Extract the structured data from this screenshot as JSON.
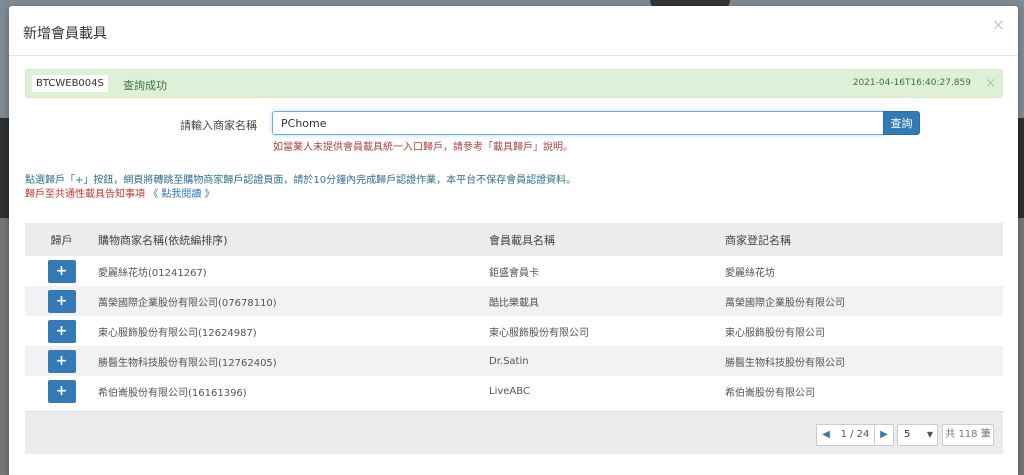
{
  "modal": {
    "title": "新增會員載具",
    "close_glyph": "×"
  },
  "alert": {
    "code": "BTCWEB004S",
    "message": "查詢成功",
    "timestamp": "2021-04-16T16:40:27.859",
    "close_glyph": "×"
  },
  "form": {
    "label": "請輸入商家名稱",
    "input_value": "PChome",
    "search_label": "查詢",
    "hint_before": "如當業人未提供會員載具統一入口歸戶，請參考「",
    "hint_link": "載具歸戶",
    "hint_after": "」說明。"
  },
  "notice": {
    "line1": "點選歸戶「+」按鈕，網頁將轉跳至購物商家歸戶認證頁面，請於10分鐘內完成歸戶認證作業，本平台不保存會員認證資料。",
    "line2_text": "歸戶至共通性載具告知事項",
    "line2_link": "《 點我閱讀 》"
  },
  "table": {
    "headers": [
      "歸戶",
      "購物商家名稱(依統編排序)",
      "會員載具名稱",
      "商家登記名稱"
    ],
    "plus_glyph": "+",
    "rows": [
      {
        "merchant": "愛麗絲花坊(01241267)",
        "carrier": "鉅盛會員卡",
        "registered": "愛麗絲花坊"
      },
      {
        "merchant": "萬榮國際企業股份有限公司(07678110)",
        "carrier": "酷比樂載具",
        "registered": "萬榮國際企業股份有限公司"
      },
      {
        "merchant": "東心服飾股份有限公司(12624987)",
        "carrier": "東心服飾股份有限公司",
        "registered": "東心服飾股份有限公司"
      },
      {
        "merchant": "勝醫生物科技股份有限公司(12762405)",
        "carrier": "Dr.Satin",
        "registered": "勝醫生物科技股份有限公司"
      },
      {
        "merchant": "希伯崙股份有限公司(16161396)",
        "carrier": "LiveABC",
        "registered": "希伯崙股份有限公司"
      }
    ]
  },
  "pagination": {
    "prev_glyph": "◀",
    "next_glyph": "▶",
    "page_info": "1 / 24",
    "page_size": "5",
    "total": "共 118 筆"
  }
}
